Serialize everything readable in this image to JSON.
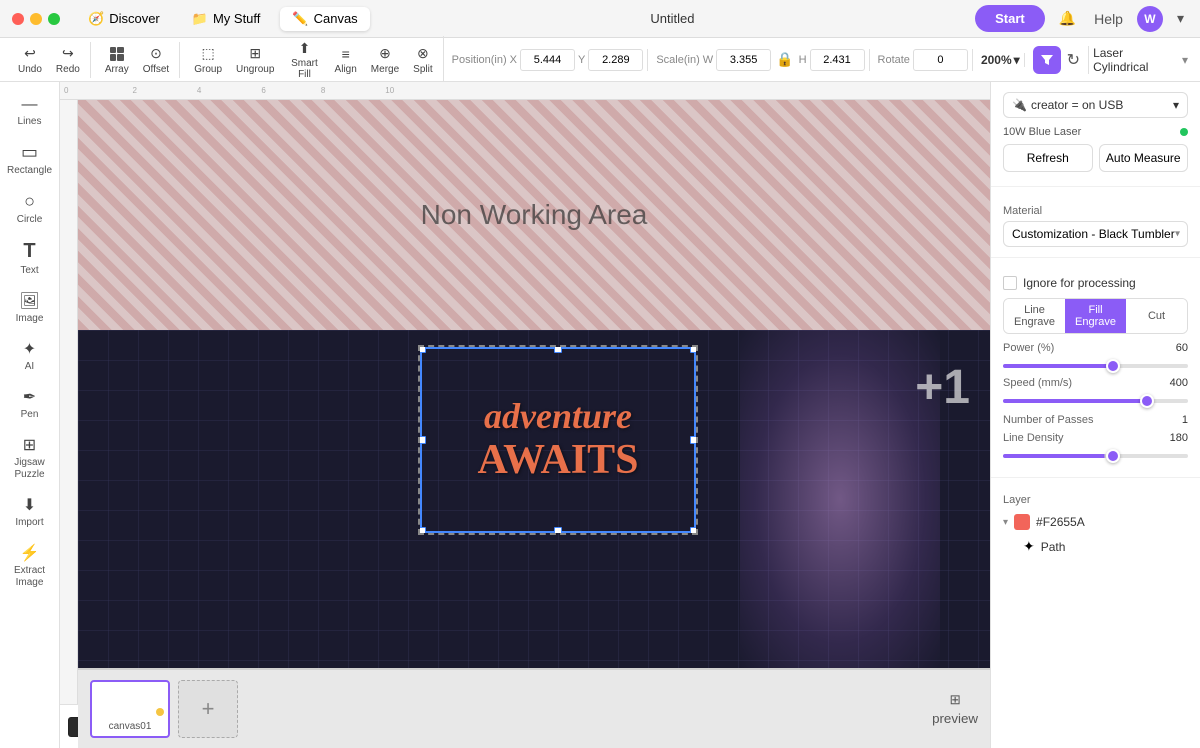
{
  "titleBar": {
    "tabs": [
      {
        "id": "discover",
        "label": "Discover",
        "icon": "🧭",
        "active": false
      },
      {
        "id": "mystuff",
        "label": "My Stuff",
        "icon": "📁",
        "active": false
      },
      {
        "id": "canvas",
        "label": "Canvas",
        "icon": "✏️",
        "active": true
      }
    ],
    "pageTitle": "Untitled",
    "startLabel": "Start",
    "helpLabel": "Help",
    "userInitial": "W"
  },
  "toolbar": {
    "undo": "Undo",
    "redo": "Redo",
    "array": "Array",
    "offset": "Offset",
    "group": "Group",
    "ungroup": "Ungroup",
    "smartFill": "Smart Fill",
    "align": "Align",
    "merge": "Merge",
    "split": "Split",
    "positionLabel": "Position(in)",
    "posX": "5.444",
    "posY": "2.289",
    "scaleLabel": "Scale(in)",
    "scaleW": "3.355",
    "scaleH": "2.431",
    "rotateLabel": "Rotate",
    "rotateVal": "0",
    "zoom": "200%",
    "filterIcon": "▼",
    "refreshIcon": "↻",
    "laserDevice": "Laser Cylindrical",
    "chevron": "▾"
  },
  "leftSidebar": {
    "items": [
      {
        "id": "lines",
        "label": "Lines",
        "icon": "—"
      },
      {
        "id": "rectangle",
        "label": "Rectangle",
        "icon": "▭"
      },
      {
        "id": "circle",
        "label": "Circle",
        "icon": "○"
      },
      {
        "id": "text",
        "label": "Text",
        "icon": "T"
      },
      {
        "id": "image",
        "label": "Image",
        "icon": "🖼"
      },
      {
        "id": "ai",
        "label": "AI",
        "icon": "✦"
      },
      {
        "id": "pen",
        "label": "Pen",
        "icon": "✒"
      },
      {
        "id": "jigsaw",
        "label": "Jigsaw Puzzle",
        "icon": "⊞"
      },
      {
        "id": "import",
        "label": "Import",
        "icon": "⬇"
      },
      {
        "id": "extract",
        "label": "Extract Image",
        "icon": "⚡"
      }
    ]
  },
  "canvas": {
    "nonWorkingText": "Non Working Area",
    "adventureLine1": "adventure",
    "adventureLine2": "AWAITS",
    "plusBadge": "+1"
  },
  "colorToolbar": {
    "colors": [
      "#2a2a2a",
      "#2266cc",
      "#4488ff",
      "#aa44cc",
      "#cc88dd",
      "#555555",
      "#3355aa",
      "#334499",
      "#880000",
      "#aa2222",
      "#cc4444",
      "#cc6633",
      "#aa8833",
      "#88aa22",
      "#44aa44",
      "#228866",
      "#226688",
      "#4466aa",
      "#6644aa",
      "#884488",
      "#cc6688",
      "#ddaaaa",
      "#ddbbcc",
      "#ccddee",
      "#4499bb",
      "#55aacc",
      "#aaddcc",
      "#bbccaa",
      "#ddccaa",
      "#eeaa66",
      "#ee8844",
      "#cc4422",
      "#0099cc"
    ]
  },
  "rightPanel": {
    "deviceSelector": "creator = on USB",
    "deviceChevron": "▾",
    "laserLabel": "10W Blue Laser",
    "refreshLabel": "Refresh",
    "autoMeasureLabel": "Auto Measure",
    "materialLabel": "Material",
    "materialValue": "Customization - Black Tumbler",
    "ignoreLabel": "Ignore for processing",
    "tabs": [
      {
        "id": "lineEngrave",
        "label": "Line Engrave",
        "active": false
      },
      {
        "id": "fillEngrave",
        "label": "Fill Engrave",
        "active": true
      },
      {
        "id": "cut",
        "label": "Cut",
        "active": false
      }
    ],
    "powerLabel": "Power (%)",
    "powerValue": "60",
    "speedLabel": "Speed (mm/s)",
    "speedValue": "400",
    "passesLabel": "Number of Passes",
    "passesValue": "1",
    "densityLabel": "Line Density",
    "densityValue": "180",
    "layerLabel": "Layer",
    "layerColor": "#F2655A",
    "layerColorHex": "#F2655A",
    "pathLabel": "Path"
  },
  "bottomStrip": {
    "canvasThumbLabel": "canvas01",
    "addCanvasIcon": "+",
    "previewLabel": "preview"
  }
}
